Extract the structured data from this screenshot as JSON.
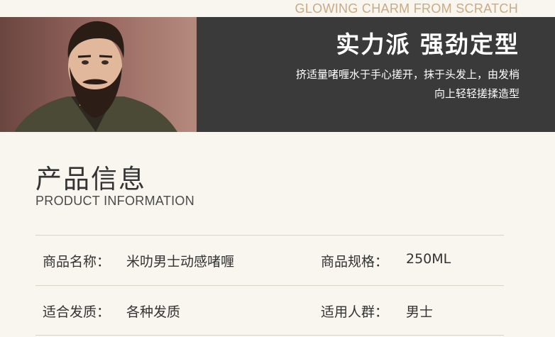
{
  "tagline": "GLOWING CHARM FROM SCRATCH",
  "banner": {
    "title": "实力派 强劲定型",
    "desc_line1": "挤适量啫喱水于手心搓开，抹于头发上，由发梢",
    "desc_line2": "向上轻轻搓揉造型"
  },
  "section": {
    "title": "产品信息",
    "subtitle": "PRODUCT INFORMATION"
  },
  "info": {
    "rows": [
      {
        "label1": "商品名称：",
        "value1": "米叻男士动感啫喱",
        "label2": "商品规格：",
        "value2": "250ML"
      },
      {
        "label1": "适合发质：",
        "value1": "各种发质",
        "label2": "适用人群：",
        "value2": "男士"
      }
    ]
  },
  "colors": {
    "background": "#f8f6ef",
    "banner": "#3a3a3a",
    "tagline": "#c9ab84"
  }
}
